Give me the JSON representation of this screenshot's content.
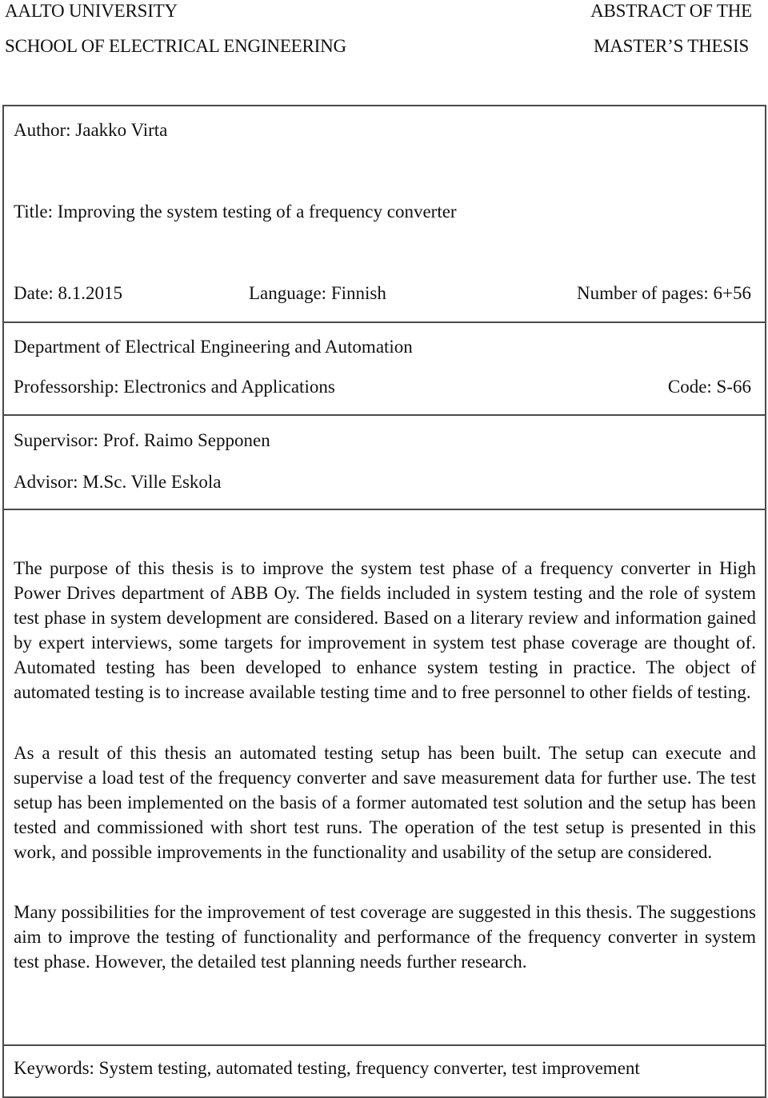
{
  "header": {
    "left_lines": [
      "AALTO UNIVERSITY",
      "SCHOOL OF ELECTRICAL ENGINEERING"
    ],
    "right_lines": [
      "ABSTRACT OF THE",
      "MASTER’S THESIS"
    ]
  },
  "info": {
    "author": "Author: Jaakko Virta",
    "title": "Title: Improving the system testing of a frequency converter",
    "date": "Date: 8.1.2015",
    "language": "Language: Finnish",
    "pages": "Number of pages: 6+56"
  },
  "department": {
    "department": "Department of Electrical Engineering and Automation",
    "professorship": "Professorship: Electronics and Applications",
    "code": "Code: S-66"
  },
  "supervision": {
    "supervisor": "Supervisor: Prof. Raimo Sepponen",
    "advisor": "Advisor: M.Sc. Ville Eskola"
  },
  "abstract": {
    "paragraphs": [
      "The purpose of this thesis is to improve the system test phase of a frequency converter in High Power Drives department of ABB Oy. The fields included in system testing and the role of system test phase in system development are considered. Based on a literary review and information gained by expert interviews, some targets for improvement in system test phase coverage are thought of. Automated testing has been developed to enhance system testing in practice. The object of automated testing is to increase available testing time and to free personnel to other fields of testing.",
      "As a result of this thesis an automated testing setup has been built. The setup can execute and supervise a load test of the frequency converter and save measurement data for further use. The test setup has been implemented on the basis of a former automated test solution and the setup has been tested and commissioned with short test runs. The operation of the test setup is presented in this work, and possible improvements in the functionality and usability of the setup are considered.",
      "Many possibilities for the improvement of test coverage are suggested in this thesis. The suggestions aim to improve the testing of functionality and performance of the frequency converter in system test phase. However, the detailed test planning needs further research."
    ]
  },
  "keywords": "Keywords: System testing, automated testing, frequency converter, test improvement"
}
